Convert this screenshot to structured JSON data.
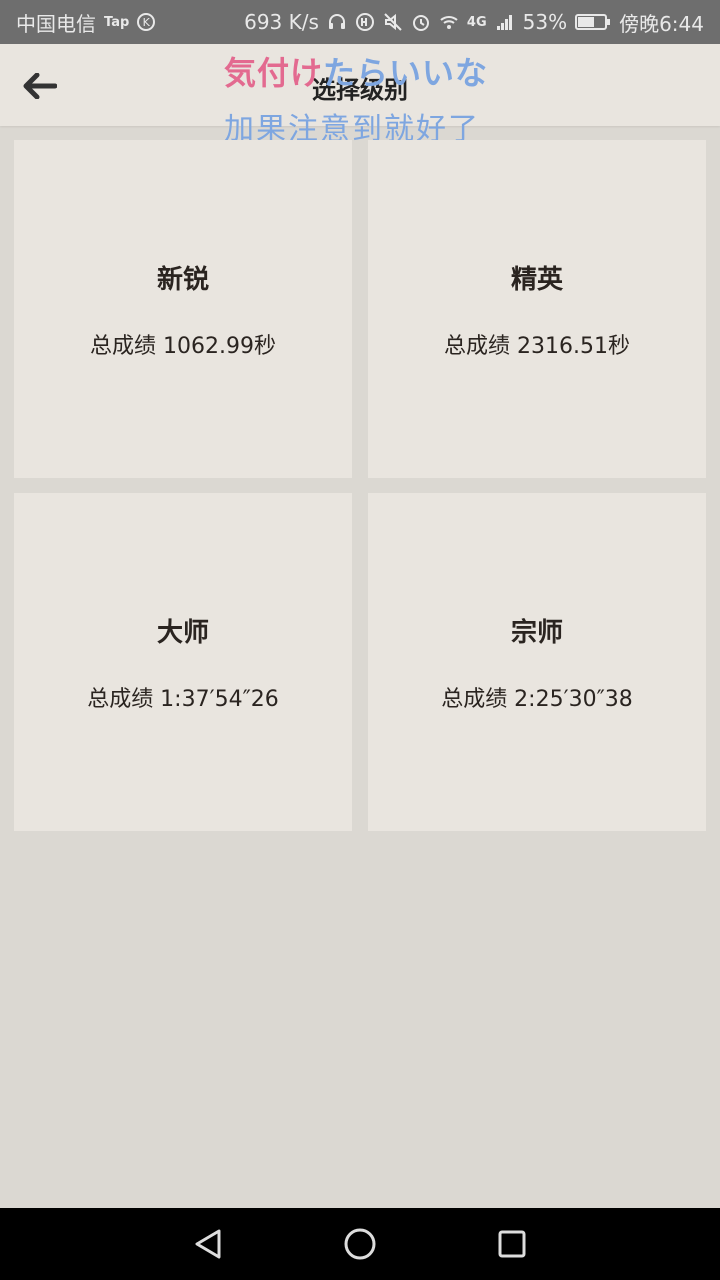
{
  "status_bar": {
    "carrier": "中国电信",
    "tap_label": "Tap",
    "k_badge": "K",
    "net_speed": "693 K/s",
    "network_tag": "4G",
    "battery": "53%",
    "time": "傍晚6:44"
  },
  "app_bar": {
    "title": "选择级别",
    "overlay_jp_red": "気付け",
    "overlay_jp_blue": "たらいいな",
    "overlay_cn": "加果注意到就好了"
  },
  "levels": [
    {
      "name": "新锐",
      "score": "总成绩 1062.99秒"
    },
    {
      "name": "精英",
      "score": "总成绩 2316.51秒"
    },
    {
      "name": "大师",
      "score": "总成绩 1:37′54″26"
    },
    {
      "name": "宗师",
      "score": "总成绩 2:25′30″38"
    }
  ]
}
